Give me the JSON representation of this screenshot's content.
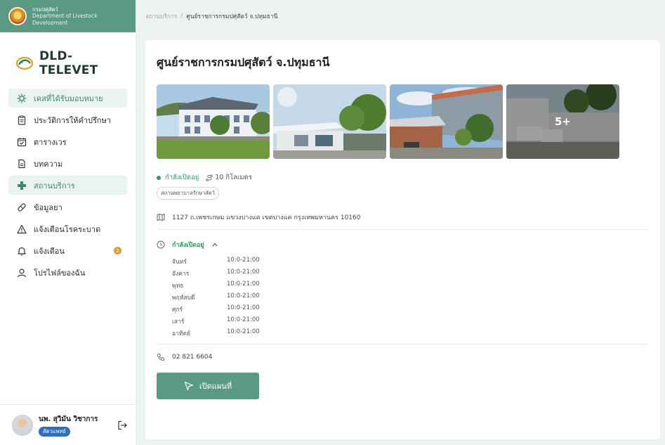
{
  "org": {
    "name_th": "กรมปศุสัตว์",
    "name_en": "Department of Livestock Development"
  },
  "brand": {
    "name": "DLD- TELEVET"
  },
  "nav": {
    "items": [
      {
        "label": "เคสที่ได้รับมอบหมาย",
        "icon": "virus-icon"
      },
      {
        "label": "ประวัติการให้คำปรึกษา",
        "icon": "clipboard-icon"
      },
      {
        "label": "ตารางเวร",
        "icon": "calendar-check-icon"
      },
      {
        "label": "บทความ",
        "icon": "document-icon"
      },
      {
        "label": "สถานบริการ",
        "icon": "plus-icon"
      },
      {
        "label": "ข้อมูลยา",
        "icon": "pill-icon"
      },
      {
        "label": "แจ้งเตือนโรคระบาด",
        "icon": "warning-icon"
      },
      {
        "label": "แจ้งเตือน",
        "icon": "bell-icon",
        "badge": "2"
      },
      {
        "label": "โปรไฟล์ของฉัน",
        "icon": "user-icon"
      }
    ]
  },
  "profile": {
    "name": "นพ. สุวิมัน วิชาการ",
    "role": "สัตวแพทย์"
  },
  "breadcrumb": {
    "parent": "สถานบริการ",
    "separator": "/",
    "current": "ศูนย์ราชการกรมปศุสัตว์ จ.ปทุมธานี"
  },
  "facility": {
    "title": "ศูนย์ราชการกรมปศุสัตว์ จ.ปทุมธานี",
    "more_photos": "5+",
    "status": "กำลังเปิดอยู่",
    "distance": "10 กิโลเมตร",
    "tag": "สถานพยาบาลรักษาสัตว์",
    "address": "1127 ถ.เพชรเกษม แขวงบางแค เขตบางแค กรุงเทพมหานคร 10160",
    "hours_status": "กำลังเปิดอยู่",
    "hours": [
      {
        "day": "จันทร์",
        "time": "10:0-21:00"
      },
      {
        "day": "อังคาร",
        "time": "10:0-21:00"
      },
      {
        "day": "พุทธ",
        "time": "10:0-21:00"
      },
      {
        "day": "พฤหัสบดี",
        "time": "10:0-21:00"
      },
      {
        "day": "ศุกร์",
        "time": "10:0-21:00"
      },
      {
        "day": "เสาร์",
        "time": "10:0-21:00"
      },
      {
        "day": "อาทิตย์",
        "time": "10:0-21:00"
      }
    ],
    "phone": "02 821 6604",
    "map_button": "เปิดแผนที่"
  },
  "colors": {
    "primary": "#5a9a82",
    "open_status": "#2a9d5c",
    "badge": "#e09a2a",
    "role_badge": "#2e6fc2"
  }
}
